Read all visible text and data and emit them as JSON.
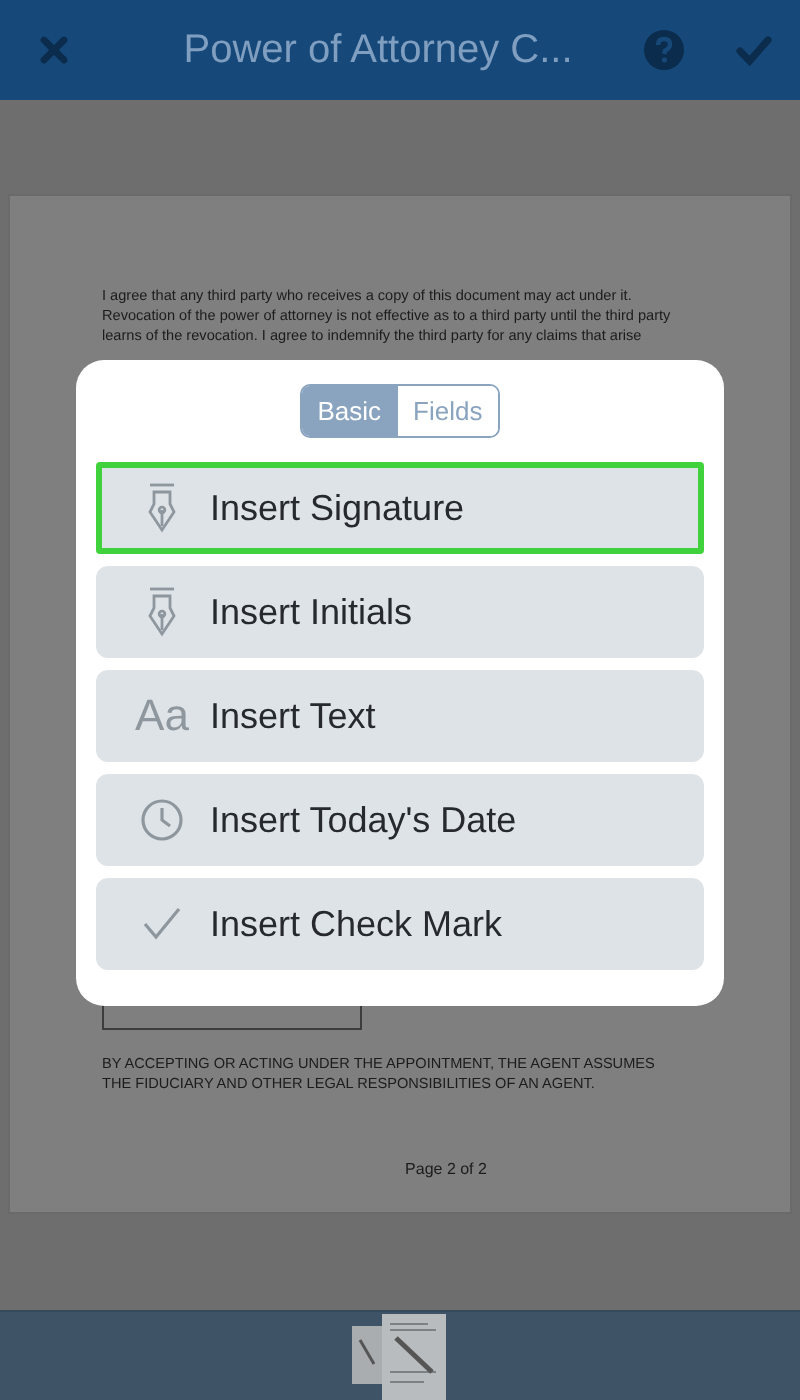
{
  "header": {
    "title": "Power of Attorney C..."
  },
  "document": {
    "paragraph_lines": [
      "I agree that any third party who receives a copy of this document may act under it.",
      "Revocation of the power of attorney is not effective as to a third party until the third party",
      "learns of the revocation. I agree to indemnify the third party for any claims that arise"
    ],
    "notice_lines": [
      "BY ACCEPTING OR ACTING UNDER THE APPOINTMENT, THE AGENT ASSUMES",
      "THE FIDUCIARY AND OTHER LEGAL RESPONSIBILITIES OF AN AGENT."
    ],
    "page_label": "Page 2 of 2"
  },
  "dialog": {
    "tabs": [
      {
        "label": "Basic",
        "selected": true
      },
      {
        "label": "Fields",
        "selected": false
      }
    ],
    "items": [
      {
        "kind": "signature",
        "label": "Insert Signature",
        "selected": true
      },
      {
        "kind": "initials",
        "label": "Insert Initials",
        "selected": false
      },
      {
        "kind": "text",
        "icon": "Aa",
        "label": "Insert Text",
        "selected": false
      },
      {
        "kind": "date",
        "label": "Insert Today's Date",
        "selected": false
      },
      {
        "kind": "check",
        "label": "Insert Check Mark",
        "selected": false
      }
    ]
  }
}
